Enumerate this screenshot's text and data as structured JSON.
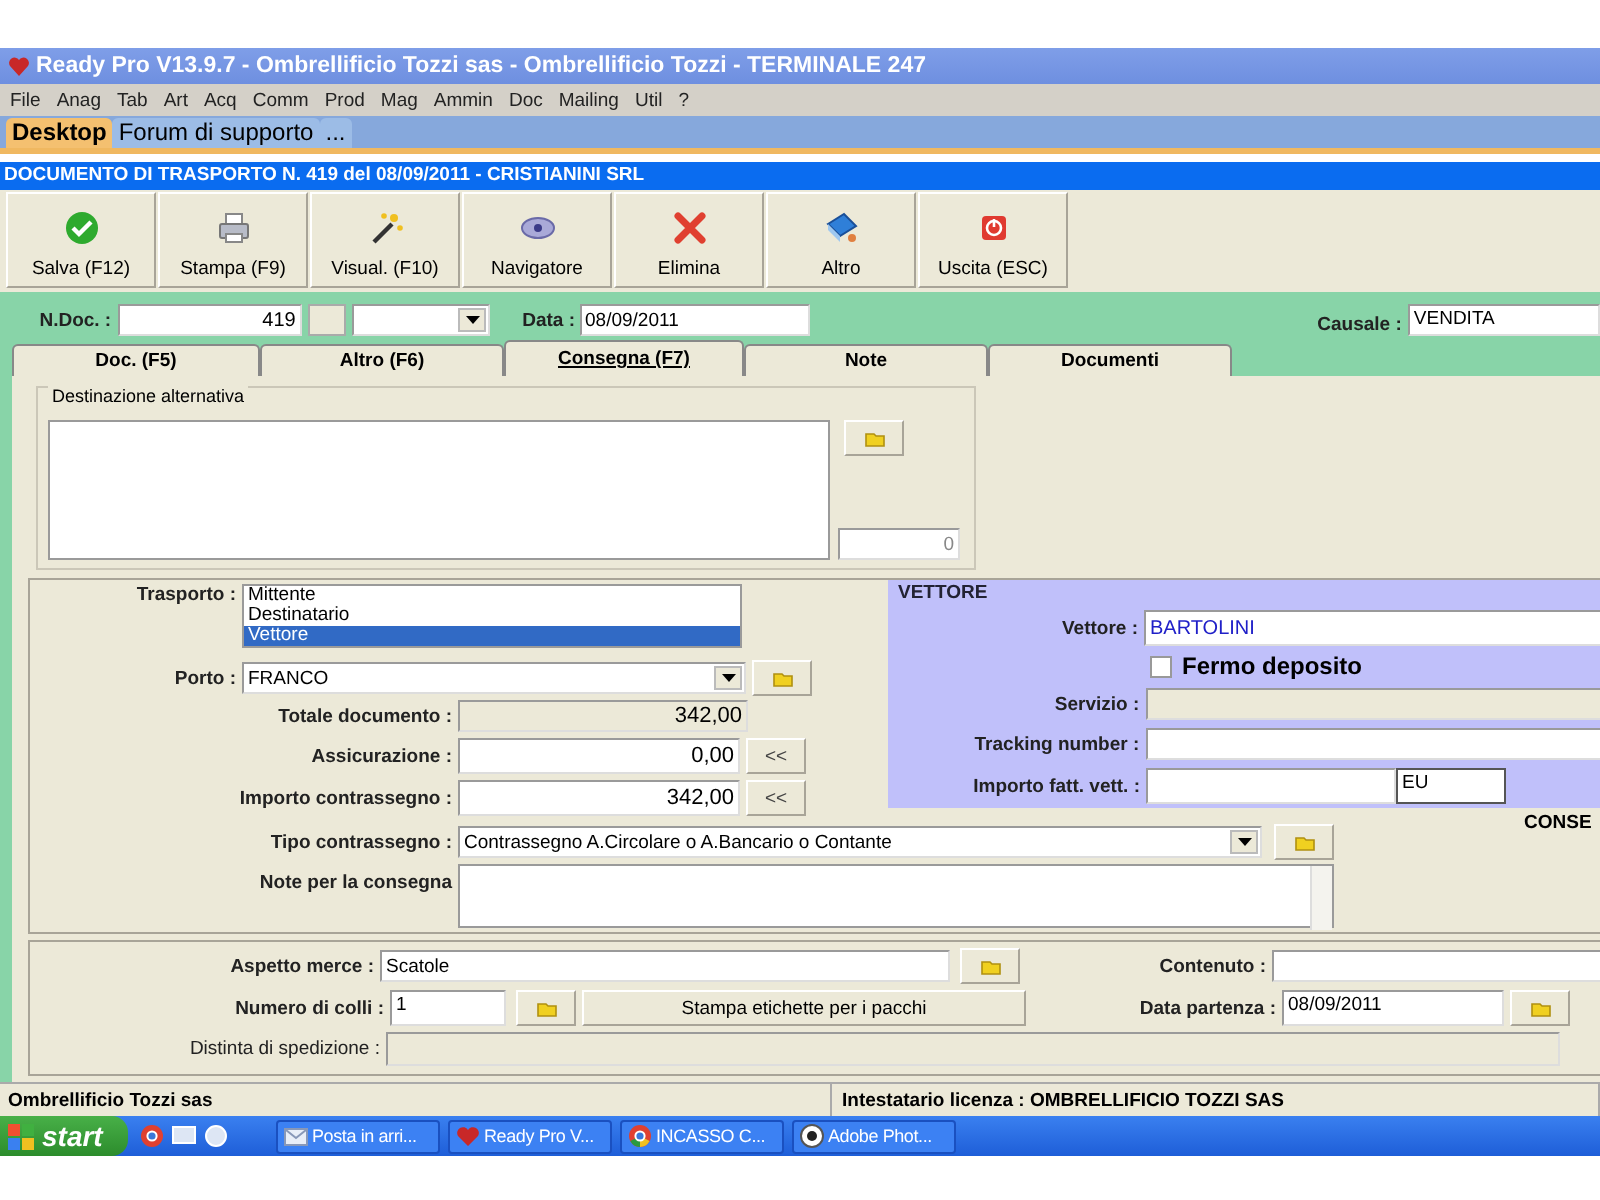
{
  "window": {
    "title": "Ready Pro V13.9.7 - Ombrellificio Tozzi sas - Ombrellificio Tozzi - TERMINALE 247"
  },
  "menu": [
    "File",
    "Anag",
    "Tab",
    "Art",
    "Acq",
    "Comm",
    "Prod",
    "Mag",
    "Ammin",
    "Doc",
    "Mailing",
    "Util",
    "?"
  ],
  "app_tabs": [
    {
      "label": "Desktop",
      "selected": true
    },
    {
      "label": "Forum di supporto",
      "selected": false
    },
    {
      "label": "...",
      "selected": false
    }
  ],
  "document_title": "DOCUMENTO DI TRASPORTO N. 419  del 08/09/2011 - CRISTIANINI SRL",
  "toolbar": [
    {
      "label": "Salva (F12)",
      "kind": "save"
    },
    {
      "label": "Stampa (F9)",
      "kind": "print"
    },
    {
      "label": "Visual. (F10)",
      "kind": "wand"
    },
    {
      "label": "Navigatore",
      "kind": "navigator"
    },
    {
      "label": "Elimina",
      "kind": "delete"
    },
    {
      "label": "Altro",
      "kind": "book"
    },
    {
      "label": "Uscita (ESC)",
      "kind": "exit"
    }
  ],
  "header": {
    "ndoc_label": "N.Doc. :",
    "ndoc_value": "419",
    "data_label": "Data :",
    "data_value": "08/09/2011",
    "causale_label": "Causale :",
    "causale_value": "VENDITA"
  },
  "tabs": [
    {
      "label": "Doc. (F5)",
      "selected": false
    },
    {
      "label": "Altro (F6)",
      "selected": false
    },
    {
      "label": "Consegna (F7)",
      "selected": true
    },
    {
      "label": "Note",
      "selected": false
    },
    {
      "label": "Documenti",
      "selected": false
    }
  ],
  "destinazione": {
    "title": "Destinazione alternativa",
    "counter": "0"
  },
  "trasporto": {
    "label": "Trasporto :",
    "options": [
      {
        "label": "Mittente",
        "selected": false
      },
      {
        "label": "Destinatario",
        "selected": false
      },
      {
        "label": "Vettore",
        "selected": true
      }
    ]
  },
  "porto": {
    "label": "Porto :",
    "value": "FRANCO"
  },
  "totale": {
    "label": "Totale documento :",
    "value": "342,00"
  },
  "assicurazione": {
    "label": "Assicurazione :",
    "value": "0,00",
    "button": "<<"
  },
  "importo_contrassegno": {
    "label": "Importo contrassegno :",
    "value": "342,00",
    "button": "<<"
  },
  "tipo_contrassegno": {
    "label": "Tipo contrassegno :",
    "value": "Contrassegno A.Circolare o A.Bancario o Contante"
  },
  "note_consegna": {
    "label": "Note per la consegna"
  },
  "vettore": {
    "title": "VETTORE",
    "vettore_label": "Vettore :",
    "vettore_value": "BARTOLINI",
    "fermo_deposito": {
      "label": "Fermo deposito",
      "checked": false
    },
    "servizio_label": "Servizio :",
    "tracking_label": "Tracking number :",
    "importo_label": "Importo fatt. vett. :",
    "currency": "EU"
  },
  "cut_label": "CONSE",
  "merce": {
    "aspetto_label": "Aspetto merce :",
    "aspetto_value": "Scatole",
    "contenuto_label": "Contenuto :",
    "colli_label": "Numero di colli :",
    "colli_value": "1",
    "stampa_button": "Stampa etichette per i pacchi",
    "data_partenza_label": "Data partenza :",
    "data_partenza_value": "08/09/2011",
    "distinta_label": "Distinta di spedizione :"
  },
  "status_bar": [
    "Ombrellificio Tozzi sas",
    "Intestatario licenza : OMBRELLIFICIO TOZZI SAS"
  ],
  "taskbar": {
    "start": "start",
    "tasks": [
      {
        "label": "Posta in arri...",
        "kind": "mail"
      },
      {
        "label": "Ready Pro V...",
        "kind": "app"
      },
      {
        "label": "INCASSO C...",
        "kind": "browser"
      },
      {
        "label": "Adobe Phot...",
        "kind": "viewer"
      }
    ]
  }
}
